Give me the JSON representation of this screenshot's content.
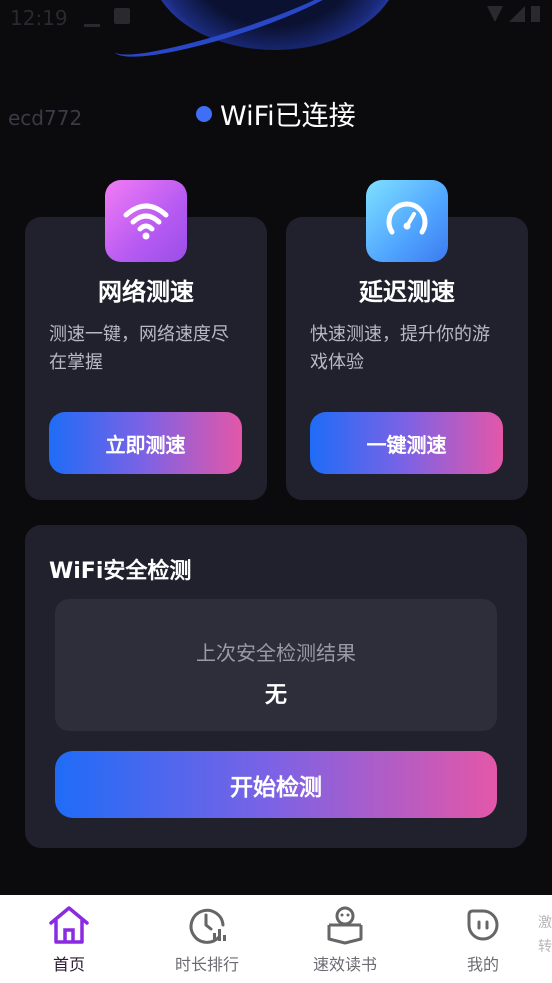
{
  "status_bar": {
    "time": "12:19"
  },
  "header": {
    "device_id": "ecd772",
    "wifi_status": "WiFi已连接"
  },
  "cards": {
    "network": {
      "title": "网络测速",
      "description": "测速一键，网络速度尽在掌握",
      "button": "立即测速",
      "icon": "wifi-icon"
    },
    "latency": {
      "title": "延迟测速",
      "description": "快速测速，提升你的游戏体验",
      "button": "一键测速",
      "icon": "gauge-icon"
    }
  },
  "security": {
    "title": "WiFi安全检测",
    "result_label": "上次安全检测结果",
    "result_value": "无",
    "button": "开始检测"
  },
  "bottom_nav": {
    "items": [
      {
        "label": "首页",
        "icon": "home-icon",
        "active": true
      },
      {
        "label": "时长排行",
        "icon": "clock-chart-icon",
        "active": false
      },
      {
        "label": "速效读书",
        "icon": "reading-icon",
        "active": false
      },
      {
        "label": "我的",
        "icon": "profile-icon",
        "active": false
      }
    ],
    "cut_off_text": "激\n转"
  },
  "colors": {
    "accent_blue": "#3e6ff6",
    "gradient_start": "#1f6cf7",
    "gradient_end": "#e357a8",
    "active_nav": "#8a2be2"
  }
}
